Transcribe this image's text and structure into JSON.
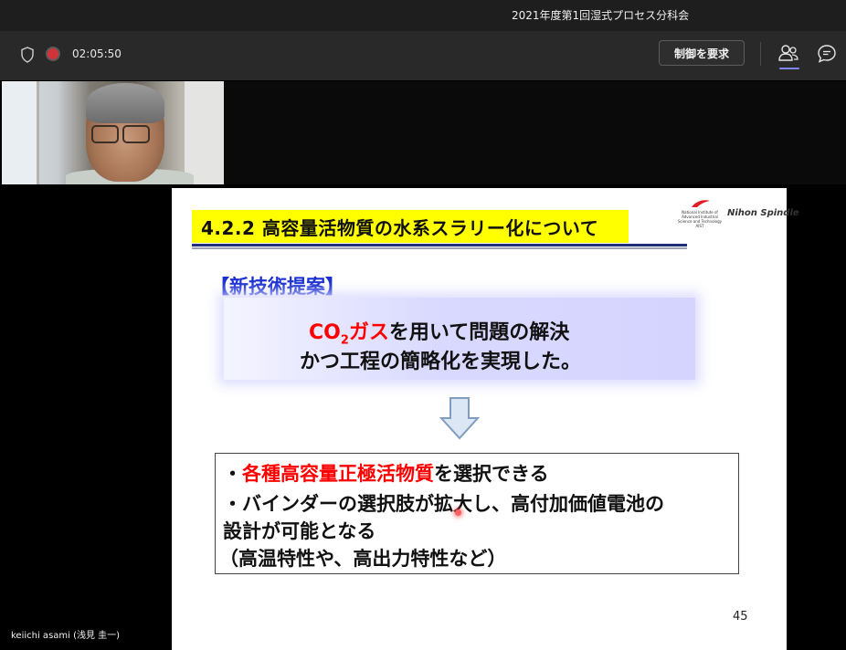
{
  "window": {
    "title": "2021年度第1回湿式プロセス分科会"
  },
  "toolbar": {
    "timer": "02:05:50",
    "request_control_label": "制御を要求",
    "icons": [
      "shield-icon",
      "recording-icon",
      "people-icon",
      "chat-icon"
    ],
    "accent_color": "#7f85f5",
    "recording_color": "#d13438"
  },
  "participant": {
    "name": "keiichi asami (浅見 圭一)"
  },
  "slide": {
    "title": "4.2.2  高容量活物質の水系スラリー化について",
    "logo_aist_text": "National Institute of Advanced Industrial Science and Technology AIST",
    "logo_nihon_text": "Nihon Spindle",
    "proposal_label": "【新技術提案】",
    "proposal_line1_co": "CO",
    "proposal_line1_sub": "2",
    "proposal_line1_gas": "ガス",
    "proposal_line1_rest": "を用いて問題の解決",
    "proposal_line2": "かつ工程の簡略化を実現した。",
    "bullet1_prefix": "・",
    "bullet1_red": "各種高容量正極活物質",
    "bullet1_rest": "を選択できる",
    "bullet2_line1": "・バインダーの選択肢が拡大し、高付加価値電池の",
    "bullet2_line2": "設計が可能となる",
    "bullet2_line3": "（高温特性や、高出力特性など）",
    "page_number": "45",
    "colors": {
      "title_bar": "#ffff00",
      "label_blue": "#1a2fd0",
      "highlight_red": "#ff0000"
    }
  }
}
